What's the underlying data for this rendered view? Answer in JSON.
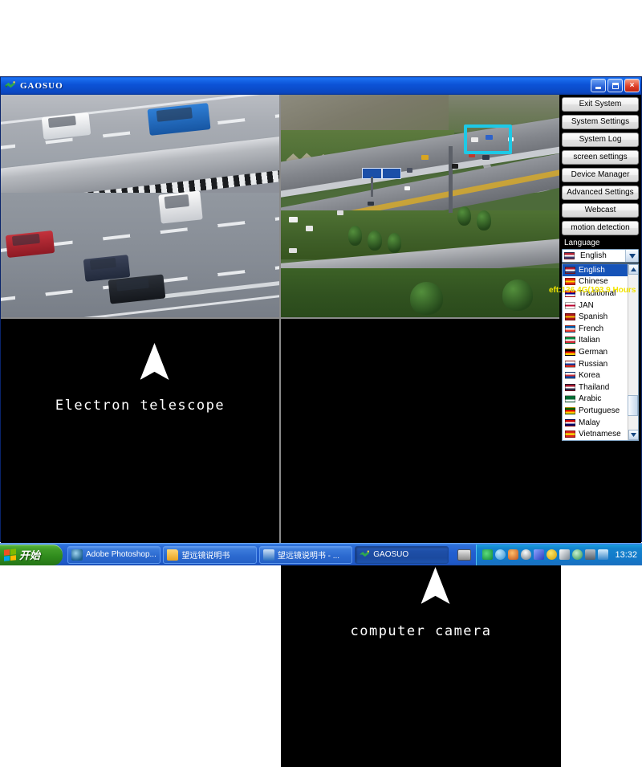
{
  "window": {
    "title": "GAOSUO",
    "icon": "app-logo-icon",
    "buttons": {
      "minimize": "minimize-icon",
      "maximize": "maximize-icon",
      "close": "×"
    }
  },
  "video_cells": [
    {
      "id": 1,
      "kind": "live-video",
      "description": "highway close-up"
    },
    {
      "id": 2,
      "kind": "live-video",
      "description": "aerial interchange",
      "roi_box_color": "#1ec9e6"
    },
    {
      "id": 3,
      "kind": "caption",
      "caption": "Electron telescope"
    },
    {
      "id": 4,
      "kind": "caption",
      "caption": "computer camera"
    }
  ],
  "control_panel": {
    "buttons": [
      "Exit System",
      "System Settings",
      "System Log",
      "screen settings",
      "Device Manager",
      "Advanced Settings",
      "Webcast",
      "motion detection"
    ],
    "language_label": "Language",
    "language_selected": "English",
    "language_options": [
      {
        "label": "English",
        "flag_colors": [
          "#b22234",
          "#ffffff",
          "#3c3b6e"
        ]
      },
      {
        "label": "Chinese",
        "flag_colors": [
          "#de2910",
          "#ffde00",
          "#de2910"
        ]
      },
      {
        "label": "Traditional",
        "flag_colors": [
          "#fe0000",
          "#000095",
          "#ffffff"
        ]
      },
      {
        "label": "JAN",
        "flag_colors": [
          "#ffffff",
          "#bc002d",
          "#ffffff"
        ]
      },
      {
        "label": "Spanish",
        "flag_colors": [
          "#aa151b",
          "#f1bf00",
          "#aa151b"
        ]
      },
      {
        "label": "French",
        "flag_colors": [
          "#0055a4",
          "#ffffff",
          "#ef4135"
        ]
      },
      {
        "label": "Italian",
        "flag_colors": [
          "#009246",
          "#ffffff",
          "#ce2b37"
        ]
      },
      {
        "label": "German",
        "flag_colors": [
          "#000000",
          "#dd0000",
          "#ffce00"
        ]
      },
      {
        "label": "Russian",
        "flag_colors": [
          "#ffffff",
          "#0039a6",
          "#d52b1e"
        ]
      },
      {
        "label": "Korea",
        "flag_colors": [
          "#ffffff",
          "#cd2e3a",
          "#0047a0"
        ]
      },
      {
        "label": "Thailand",
        "flag_colors": [
          "#a51931",
          "#ffffff",
          "#2d2a4a"
        ]
      },
      {
        "label": "Arabic",
        "flag_colors": [
          "#006c35",
          "#006c35",
          "#ffffff"
        ]
      },
      {
        "label": "Portuguese",
        "flag_colors": [
          "#006600",
          "#ff0000",
          "#ffcc00"
        ]
      },
      {
        "label": "Malay",
        "flag_colors": [
          "#cc0001",
          "#ffffff",
          "#010066"
        ]
      },
      {
        "label": "Vietnamese",
        "flag_colors": [
          "#da251d",
          "#ffff00",
          "#da251d"
        ]
      }
    ],
    "status_text": "eft:136.4G(193.9 Hours",
    "status_color": "#f2e400"
  },
  "taskbar": {
    "start_label": "开始",
    "items": [
      {
        "label": "Adobe Photoshop...",
        "icon": "photoshop-icon",
        "active": false
      },
      {
        "label": "望远镜说明书",
        "icon": "folder-icon",
        "active": false
      },
      {
        "label": "望远镜说明书 - ...",
        "icon": "word-icon",
        "active": false
      },
      {
        "label": "GAOSUO",
        "icon": "app-logo-icon",
        "active": true
      }
    ],
    "tray_icons": [
      "gaosuo-tray-icon",
      "messenger-tray-icon",
      "antivirus-tray-icon",
      "qq-tray-icon",
      "network-tray-icon",
      "update-tray-icon",
      "volume-tray-icon",
      "refresh-tray-icon",
      "camera-tray-icon",
      "battery-tray-icon"
    ],
    "clock": "13:32"
  }
}
